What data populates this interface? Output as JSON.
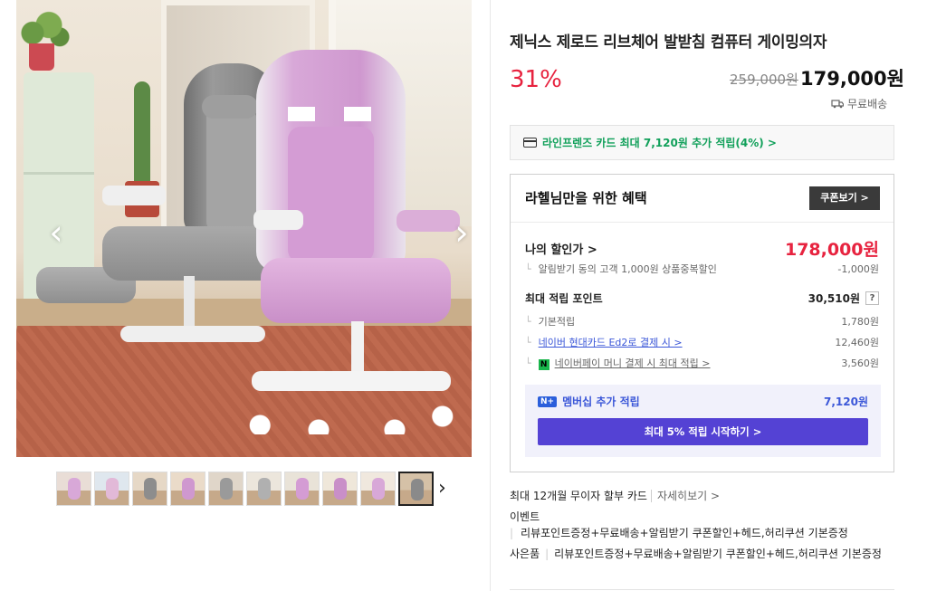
{
  "product": {
    "title": "제닉스 제로드 리브체어 발받침 컴퓨터 게이밍의자",
    "discount": "31%",
    "old_price": "259,000원",
    "price": "179,000원",
    "shipping": "무료배송"
  },
  "gallery": {
    "prev_icon": "‹",
    "next_icon": "›",
    "thumb_next_icon": "›",
    "thumbnails": [
      "thumb1",
      "thumb2",
      "thumb3",
      "thumb4",
      "thumb5",
      "thumb6",
      "thumb7",
      "thumb8",
      "thumb9",
      "thumb10"
    ],
    "active_index": 9
  },
  "card_promo": "라인프렌즈 카드 최대 7,120원 추가 적립(4%) >",
  "benefit": {
    "title": "라헬님만을 위한 혜택",
    "coupon_button": "쿠폰보기 >",
    "my_price_label": "나의 할인가 >",
    "my_price_value": "178,000원",
    "alarm_label": "알림받기 동의 고객 1,000원 상품중복할인",
    "alarm_value": "-1,000원",
    "max_point_label": "최대 적립 포인트",
    "max_point_value": "30,510원",
    "question_icon": "?",
    "basic_label": "기본적립",
    "basic_value": "1,780원",
    "hyundai_label": "네이버 현대카드 Ed2로 결제 시 >",
    "hyundai_value": "12,460원",
    "npay_label": "네이버페이 머니 결제 시 최대 적립 >",
    "npay_value": "3,560원",
    "npay_icon": "N",
    "member_badge": "N+",
    "member_label": "멤버십 추가 적립",
    "member_value": "7,120원",
    "member_button": "최대 5% 적립 시작하기 >"
  },
  "installment": {
    "text": "최대 12개월 무이자 할부 카드",
    "more": "자세히보기 >"
  },
  "event": {
    "label": "이벤트",
    "text": "리뷰포인트증정+무료배송+알림받기 쿠폰할인+헤드,허리쿠션 기본증정"
  },
  "gift": {
    "label": "사은품",
    "text": "리뷰포인트증정+무료배송+알림받기 쿠폰할인+헤드,허리쿠션 기본증정"
  },
  "colors": {
    "accent_red": "#e7233f",
    "accent_green": "#11a05a",
    "accent_blue": "#3b57d8",
    "member_button": "#5442d4"
  }
}
